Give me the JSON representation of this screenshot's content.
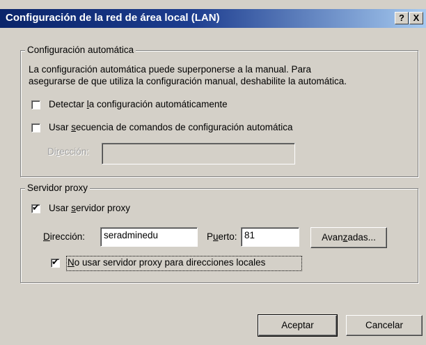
{
  "window": {
    "title": "Configuración de la red de área local (LAN)",
    "help_button": "?",
    "close_button": "X"
  },
  "auto_config": {
    "legend": "Configuración automática",
    "description_line1": "La configuración automática puede superponerse a la manual.  Para",
    "description_line2": "asegurarse de que utiliza la configuración manual, deshabilite la automática.",
    "detect_checked": false,
    "detect_pre": "Detectar ",
    "detect_accel": "l",
    "detect_post": "a configuración automáticamente",
    "script_checked": false,
    "script_pre": "Usar ",
    "script_accel": "s",
    "script_post": "ecuencia de comandos de configuración automática",
    "address_label_pre": "Di",
    "address_label_accel": "r",
    "address_label_post": "ección:",
    "address_value": ""
  },
  "proxy": {
    "legend": "Servidor proxy",
    "use_proxy_checked": true,
    "use_proxy_pre": "Usar ",
    "use_proxy_accel": "s",
    "use_proxy_post": "ervidor proxy",
    "address_label_accel": "D",
    "address_label_post": "irección:",
    "address_value": "seradminedu",
    "port_label_pre": "P",
    "port_label_accel": "u",
    "port_label_post": "erto:",
    "port_value": "81",
    "advanced_pre": "Avan",
    "advanced_accel": "z",
    "advanced_post": "adas...",
    "bypass_local_checked": true,
    "bypass_accel": "N",
    "bypass_post": "o usar servidor proxy para direcciones locales"
  },
  "buttons": {
    "ok": "Aceptar",
    "cancel": "Cancelar"
  }
}
